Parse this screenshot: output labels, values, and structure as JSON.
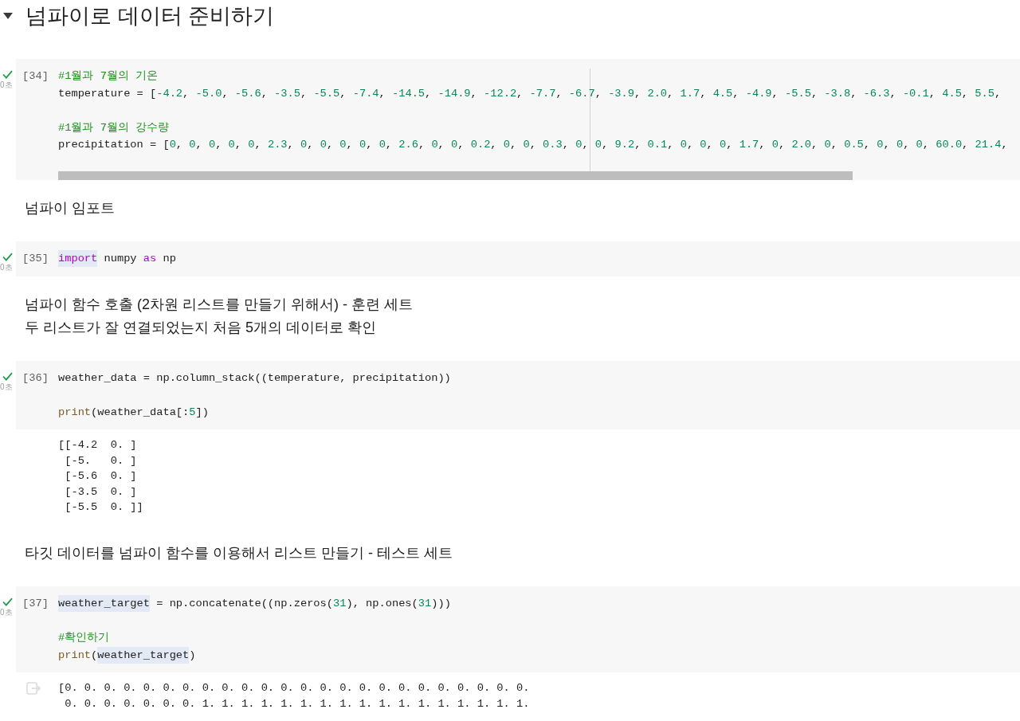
{
  "section": {
    "title": "넘파이로 데이터 준비하기",
    "expanded": true
  },
  "cells": [
    {
      "kind": "code",
      "count": "[34]",
      "runtime": "0초",
      "done": true,
      "focused": true,
      "scrollable": true,
      "lines": [
        {
          "kind": "code",
          "tokens": [
            {
              "kind": "comment",
              "text": "#1월과 7월의 기온"
            }
          ]
        },
        {
          "kind": "code",
          "tokens": [
            {
              "kind": "plain",
              "text": "temperature = ["
            },
            {
              "kind": "number",
              "text": "-4.2"
            },
            {
              "kind": "plain",
              "text": ", "
            },
            {
              "kind": "number",
              "text": "-5.0"
            },
            {
              "kind": "plain",
              "text": ", "
            },
            {
              "kind": "number",
              "text": "-5.6"
            },
            {
              "kind": "plain",
              "text": ", "
            },
            {
              "kind": "number",
              "text": "-3.5"
            },
            {
              "kind": "plain",
              "text": ", "
            },
            {
              "kind": "number",
              "text": "-5.5"
            },
            {
              "kind": "plain",
              "text": ", "
            },
            {
              "kind": "number",
              "text": "-7.4"
            },
            {
              "kind": "plain",
              "text": ", "
            },
            {
              "kind": "number",
              "text": "-14.5"
            },
            {
              "kind": "plain",
              "text": ", "
            },
            {
              "kind": "number",
              "text": "-14.9"
            },
            {
              "kind": "plain",
              "text": ", "
            },
            {
              "kind": "number",
              "text": "-12.2"
            },
            {
              "kind": "plain",
              "text": ", "
            },
            {
              "kind": "number",
              "text": "-7.7"
            },
            {
              "kind": "plain",
              "text": ", "
            },
            {
              "kind": "number",
              "text": "-6.7"
            },
            {
              "kind": "plain",
              "text": ", "
            },
            {
              "kind": "number",
              "text": "-3.9"
            },
            {
              "kind": "plain",
              "text": ", "
            },
            {
              "kind": "number",
              "text": "2.0"
            },
            {
              "kind": "plain",
              "text": ", "
            },
            {
              "kind": "number",
              "text": "1.7"
            },
            {
              "kind": "plain",
              "text": ", "
            },
            {
              "kind": "number",
              "text": "4.5"
            },
            {
              "kind": "plain",
              "text": ", "
            },
            {
              "kind": "number",
              "text": "-4.9"
            },
            {
              "kind": "plain",
              "text": ", "
            },
            {
              "kind": "number",
              "text": "-5.5"
            },
            {
              "kind": "plain",
              "text": ", "
            },
            {
              "kind": "number",
              "text": "-3.8"
            },
            {
              "kind": "plain",
              "text": ", "
            },
            {
              "kind": "number",
              "text": "-6.3"
            },
            {
              "kind": "plain",
              "text": ", "
            },
            {
              "kind": "number",
              "text": "-0.1"
            },
            {
              "kind": "plain",
              "text": ", "
            },
            {
              "kind": "number",
              "text": "4.5"
            },
            {
              "kind": "plain",
              "text": ", "
            },
            {
              "kind": "number",
              "text": "5.5"
            },
            {
              "kind": "plain",
              "text": ","
            }
          ]
        },
        {
          "kind": "blank"
        },
        {
          "kind": "code",
          "tokens": [
            {
              "kind": "comment",
              "text": "#1월과 7월의 강수량"
            }
          ]
        },
        {
          "kind": "code",
          "tokens": [
            {
              "kind": "plain",
              "text": "precipitation = ["
            },
            {
              "kind": "number",
              "text": "0"
            },
            {
              "kind": "plain",
              "text": ", "
            },
            {
              "kind": "number",
              "text": "0"
            },
            {
              "kind": "plain",
              "text": ", "
            },
            {
              "kind": "number",
              "text": "0"
            },
            {
              "kind": "plain",
              "text": ", "
            },
            {
              "kind": "number",
              "text": "0"
            },
            {
              "kind": "plain",
              "text": ", "
            },
            {
              "kind": "number",
              "text": "0"
            },
            {
              "kind": "plain",
              "text": ", "
            },
            {
              "kind": "number",
              "text": "2.3"
            },
            {
              "kind": "plain",
              "text": ", "
            },
            {
              "kind": "number",
              "text": "0"
            },
            {
              "kind": "plain",
              "text": ", "
            },
            {
              "kind": "number",
              "text": "0"
            },
            {
              "kind": "plain",
              "text": ", "
            },
            {
              "kind": "number",
              "text": "0"
            },
            {
              "kind": "plain",
              "text": ", "
            },
            {
              "kind": "number",
              "text": "0"
            },
            {
              "kind": "plain",
              "text": ", "
            },
            {
              "kind": "number",
              "text": "0"
            },
            {
              "kind": "plain",
              "text": ", "
            },
            {
              "kind": "number",
              "text": "2.6"
            },
            {
              "kind": "plain",
              "text": ", "
            },
            {
              "kind": "number",
              "text": "0"
            },
            {
              "kind": "plain",
              "text": ", "
            },
            {
              "kind": "number",
              "text": "0"
            },
            {
              "kind": "plain",
              "text": ", "
            },
            {
              "kind": "number",
              "text": "0.2"
            },
            {
              "kind": "plain",
              "text": ", "
            },
            {
              "kind": "number",
              "text": "0"
            },
            {
              "kind": "plain",
              "text": ", "
            },
            {
              "kind": "number",
              "text": "0"
            },
            {
              "kind": "plain",
              "text": ", "
            },
            {
              "kind": "number",
              "text": "0.3"
            },
            {
              "kind": "plain",
              "text": ", "
            },
            {
              "kind": "number",
              "text": "0"
            },
            {
              "kind": "plain",
              "text": ", "
            },
            {
              "kind": "number",
              "text": "0"
            },
            {
              "kind": "plain",
              "text": ", "
            },
            {
              "kind": "number",
              "text": "9.2"
            },
            {
              "kind": "plain",
              "text": ", "
            },
            {
              "kind": "number",
              "text": "0.1"
            },
            {
              "kind": "plain",
              "text": ", "
            },
            {
              "kind": "number",
              "text": "0"
            },
            {
              "kind": "plain",
              "text": ", "
            },
            {
              "kind": "number",
              "text": "0"
            },
            {
              "kind": "plain",
              "text": ", "
            },
            {
              "kind": "number",
              "text": "0"
            },
            {
              "kind": "plain",
              "text": ", "
            },
            {
              "kind": "number",
              "text": "1.7"
            },
            {
              "kind": "plain",
              "text": ", "
            },
            {
              "kind": "number",
              "text": "0"
            },
            {
              "kind": "plain",
              "text": ", "
            },
            {
              "kind": "number",
              "text": "2.0"
            },
            {
              "kind": "plain",
              "text": ", "
            },
            {
              "kind": "number",
              "text": "0"
            },
            {
              "kind": "plain",
              "text": ", "
            },
            {
              "kind": "number",
              "text": "0.5"
            },
            {
              "kind": "plain",
              "text": ", "
            },
            {
              "kind": "number",
              "text": "0"
            },
            {
              "kind": "plain",
              "text": ", "
            },
            {
              "kind": "number",
              "text": "0"
            },
            {
              "kind": "plain",
              "text": ", "
            },
            {
              "kind": "number",
              "text": "0"
            },
            {
              "kind": "plain",
              "text": ", "
            },
            {
              "kind": "number",
              "text": "60.0"
            },
            {
              "kind": "plain",
              "text": ", "
            },
            {
              "kind": "number",
              "text": "21.4"
            },
            {
              "kind": "plain",
              "text": ","
            }
          ]
        }
      ]
    },
    {
      "kind": "text",
      "lines": [
        "넘파이 임포트"
      ]
    },
    {
      "kind": "code",
      "count": "[35]",
      "runtime": "0초",
      "done": true,
      "focused": false,
      "scrollable": false,
      "lines": [
        {
          "kind": "code",
          "tokens": [
            {
              "kind": "keyword",
              "text": "import",
              "marked": true
            },
            {
              "kind": "plain",
              "text": " numpy ",
              "marked": false
            },
            {
              "kind": "keyword",
              "text": "as",
              "marked": false
            },
            {
              "kind": "plain",
              "text": " np",
              "marked": false
            }
          ]
        }
      ]
    },
    {
      "kind": "text",
      "lines": [
        "넘파이 함수 호출 (2차원 리스트를 만들기 위해서) - 훈련 세트",
        "두 리스트가 잘 연결되었는지 처음 5개의 데이터로 확인"
      ]
    },
    {
      "kind": "code",
      "count": "[36]",
      "runtime": "0초",
      "done": true,
      "focused": false,
      "scrollable": false,
      "lines": [
        {
          "kind": "code",
          "tokens": [
            {
              "kind": "plain",
              "text": "weather_data = np.column_stack((temperature, precipitation))"
            }
          ]
        },
        {
          "kind": "blank"
        },
        {
          "kind": "code",
          "tokens": [
            {
              "kind": "function",
              "text": "print"
            },
            {
              "kind": "plain",
              "text": "(weather_data[:"
            },
            {
              "kind": "number",
              "text": "5"
            },
            {
              "kind": "plain",
              "text": "])"
            }
          ]
        }
      ],
      "output": {
        "hovered": false,
        "lines": [
          "[[-4.2  0. ]",
          " [-5.   0. ]",
          " [-5.6  0. ]",
          " [-3.5  0. ]",
          " [-5.5  0. ]]"
        ]
      }
    },
    {
      "kind": "text",
      "lines": [
        "타깃 데이터를 넘파이 함수를 이용해서 리스트 만들기 - 테스트 세트"
      ]
    },
    {
      "kind": "code",
      "count": "[37]",
      "runtime": "0초",
      "done": true,
      "focused": false,
      "scrollable": false,
      "lines": [
        {
          "kind": "code",
          "tokens": [
            {
              "kind": "plain",
              "text": "weather_target",
              "marked": true
            },
            {
              "kind": "plain",
              "text": " = np.concatenate((np.zeros(",
              "marked": false
            },
            {
              "kind": "number",
              "text": "31",
              "marked": false
            },
            {
              "kind": "plain",
              "text": "), np.ones(",
              "marked": false
            },
            {
              "kind": "number",
              "text": "31",
              "marked": false
            },
            {
              "kind": "plain",
              "text": ")))",
              "marked": false
            }
          ]
        },
        {
          "kind": "blank"
        },
        {
          "kind": "code",
          "tokens": [
            {
              "kind": "comment",
              "text": "#확인하기"
            }
          ]
        },
        {
          "kind": "code",
          "tokens": [
            {
              "kind": "function",
              "text": "print",
              "marked": false
            },
            {
              "kind": "plain",
              "text": "(",
              "marked": false
            },
            {
              "kind": "plain",
              "text": "weather_target",
              "marked": true
            },
            {
              "kind": "plain",
              "text": ")",
              "marked": false
            }
          ]
        }
      ],
      "output": {
        "hovered": true,
        "lines": [
          "[0. 0. 0. 0. 0. 0. 0. 0. 0. 0. 0. 0. 0. 0. 0. 0. 0. 0. 0. 0. 0. 0. 0. 0.",
          " 0. 0. 0. 0. 0. 0. 0. 1. 1. 1. 1. 1. 1. 1. 1. 1. 1. 1. 1. 1. 1. 1. 1. 1."
        ]
      }
    }
  ]
}
